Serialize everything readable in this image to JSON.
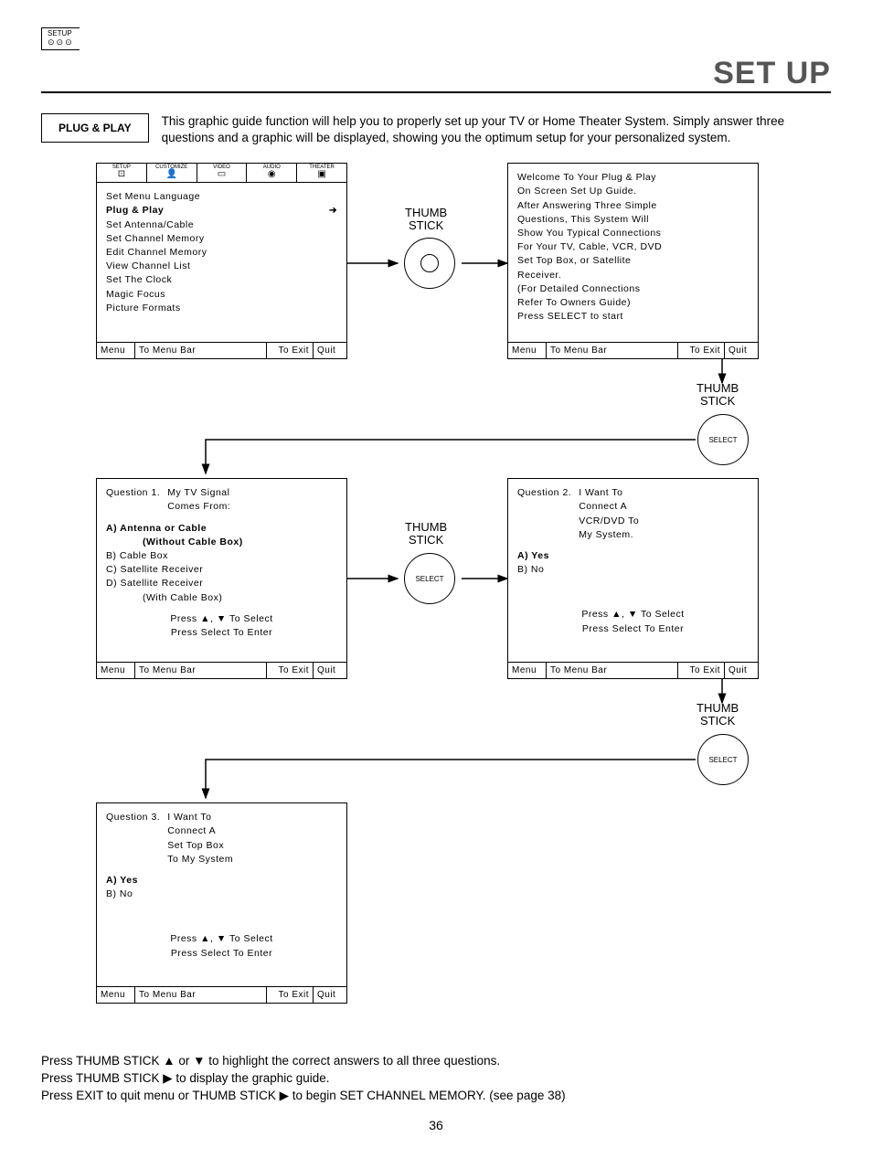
{
  "badge_label": "SETUP",
  "page_title": "SET UP",
  "section_label": "PLUG & PLAY",
  "intro": "This graphic guide function will help you to properly set up your TV or Home Theater System.  Simply answer three questions and a graphic will be displayed, showing you the optimum setup for your personalized system.",
  "tabs": {
    "t1": "SETUP",
    "t2": "CUSTOMIZE",
    "t3": "VIDEO",
    "t4": "AUDIO",
    "t5": "THEATER"
  },
  "screen1": {
    "m0": "Set Menu Language",
    "m1": "Plug & Play",
    "m2": "Set Antenna/Cable",
    "m3": "Set Channel Memory",
    "m4": "Edit Channel Memory",
    "m5": "View Channel List",
    "m6": "Set The Clock",
    "m7": "Magic Focus",
    "m8": "Picture Formats"
  },
  "screen2": {
    "l1": "Welcome To Your Plug & Play",
    "l2": "On Screen Set Up Guide.",
    "l3": "After Answering Three Simple",
    "l4": "Questions, This System Will",
    "l5": "Show You Typical Connections",
    "l6": "For Your TV, Cable, VCR, DVD",
    "l7": "Set Top Box, or Satellite",
    "l8": "Receiver.",
    "l9": "(For Detailed Connections",
    "l10": "Refer To Owners Guide)",
    "l11": "Press SELECT to start"
  },
  "screen3": {
    "q": "Question 1.",
    "qt": "My TV Signal",
    "qt2": "Comes From:",
    "a": "A) Antenna or Cable",
    "asub": "(Without Cable Box)",
    "b": "B) Cable Box",
    "c": "C) Satellite Receiver",
    "d": "D) Satellite Receiver",
    "dsub": "(With Cable Box)"
  },
  "screen4": {
    "q": "Question 2.",
    "qt": "I Want To",
    "qt2": "Connect A",
    "qt3": "VCR/DVD To",
    "qt4": "My System.",
    "a": "A) Yes",
    "b": "B) No"
  },
  "screen5": {
    "q": "Question 3.",
    "qt": "I Want To",
    "qt2": "Connect A",
    "qt3": "Set Top Box",
    "qt4": "To My System",
    "a": "A) Yes",
    "b": "B) No"
  },
  "instr1": "Press ▲, ▼ To Select",
  "instr2": "Press Select To Enter",
  "footer": {
    "menu": "Menu",
    "tobar": "To Menu Bar",
    "exit": "To Exit",
    "quit": "Quit"
  },
  "thumb": "THUMB",
  "stick": "STICK",
  "select": "SELECT",
  "bottom": {
    "l1": "Press  THUMB STICK ▲ or ▼ to highlight the correct answers to all three questions.",
    "l2": "Press THUMB STICK ▶ to display the graphic guide.",
    "l3": "Press EXIT to quit menu or THUMB STICK ▶ to begin SET CHANNEL MEMORY. (see page 38)"
  },
  "page_number": "36"
}
